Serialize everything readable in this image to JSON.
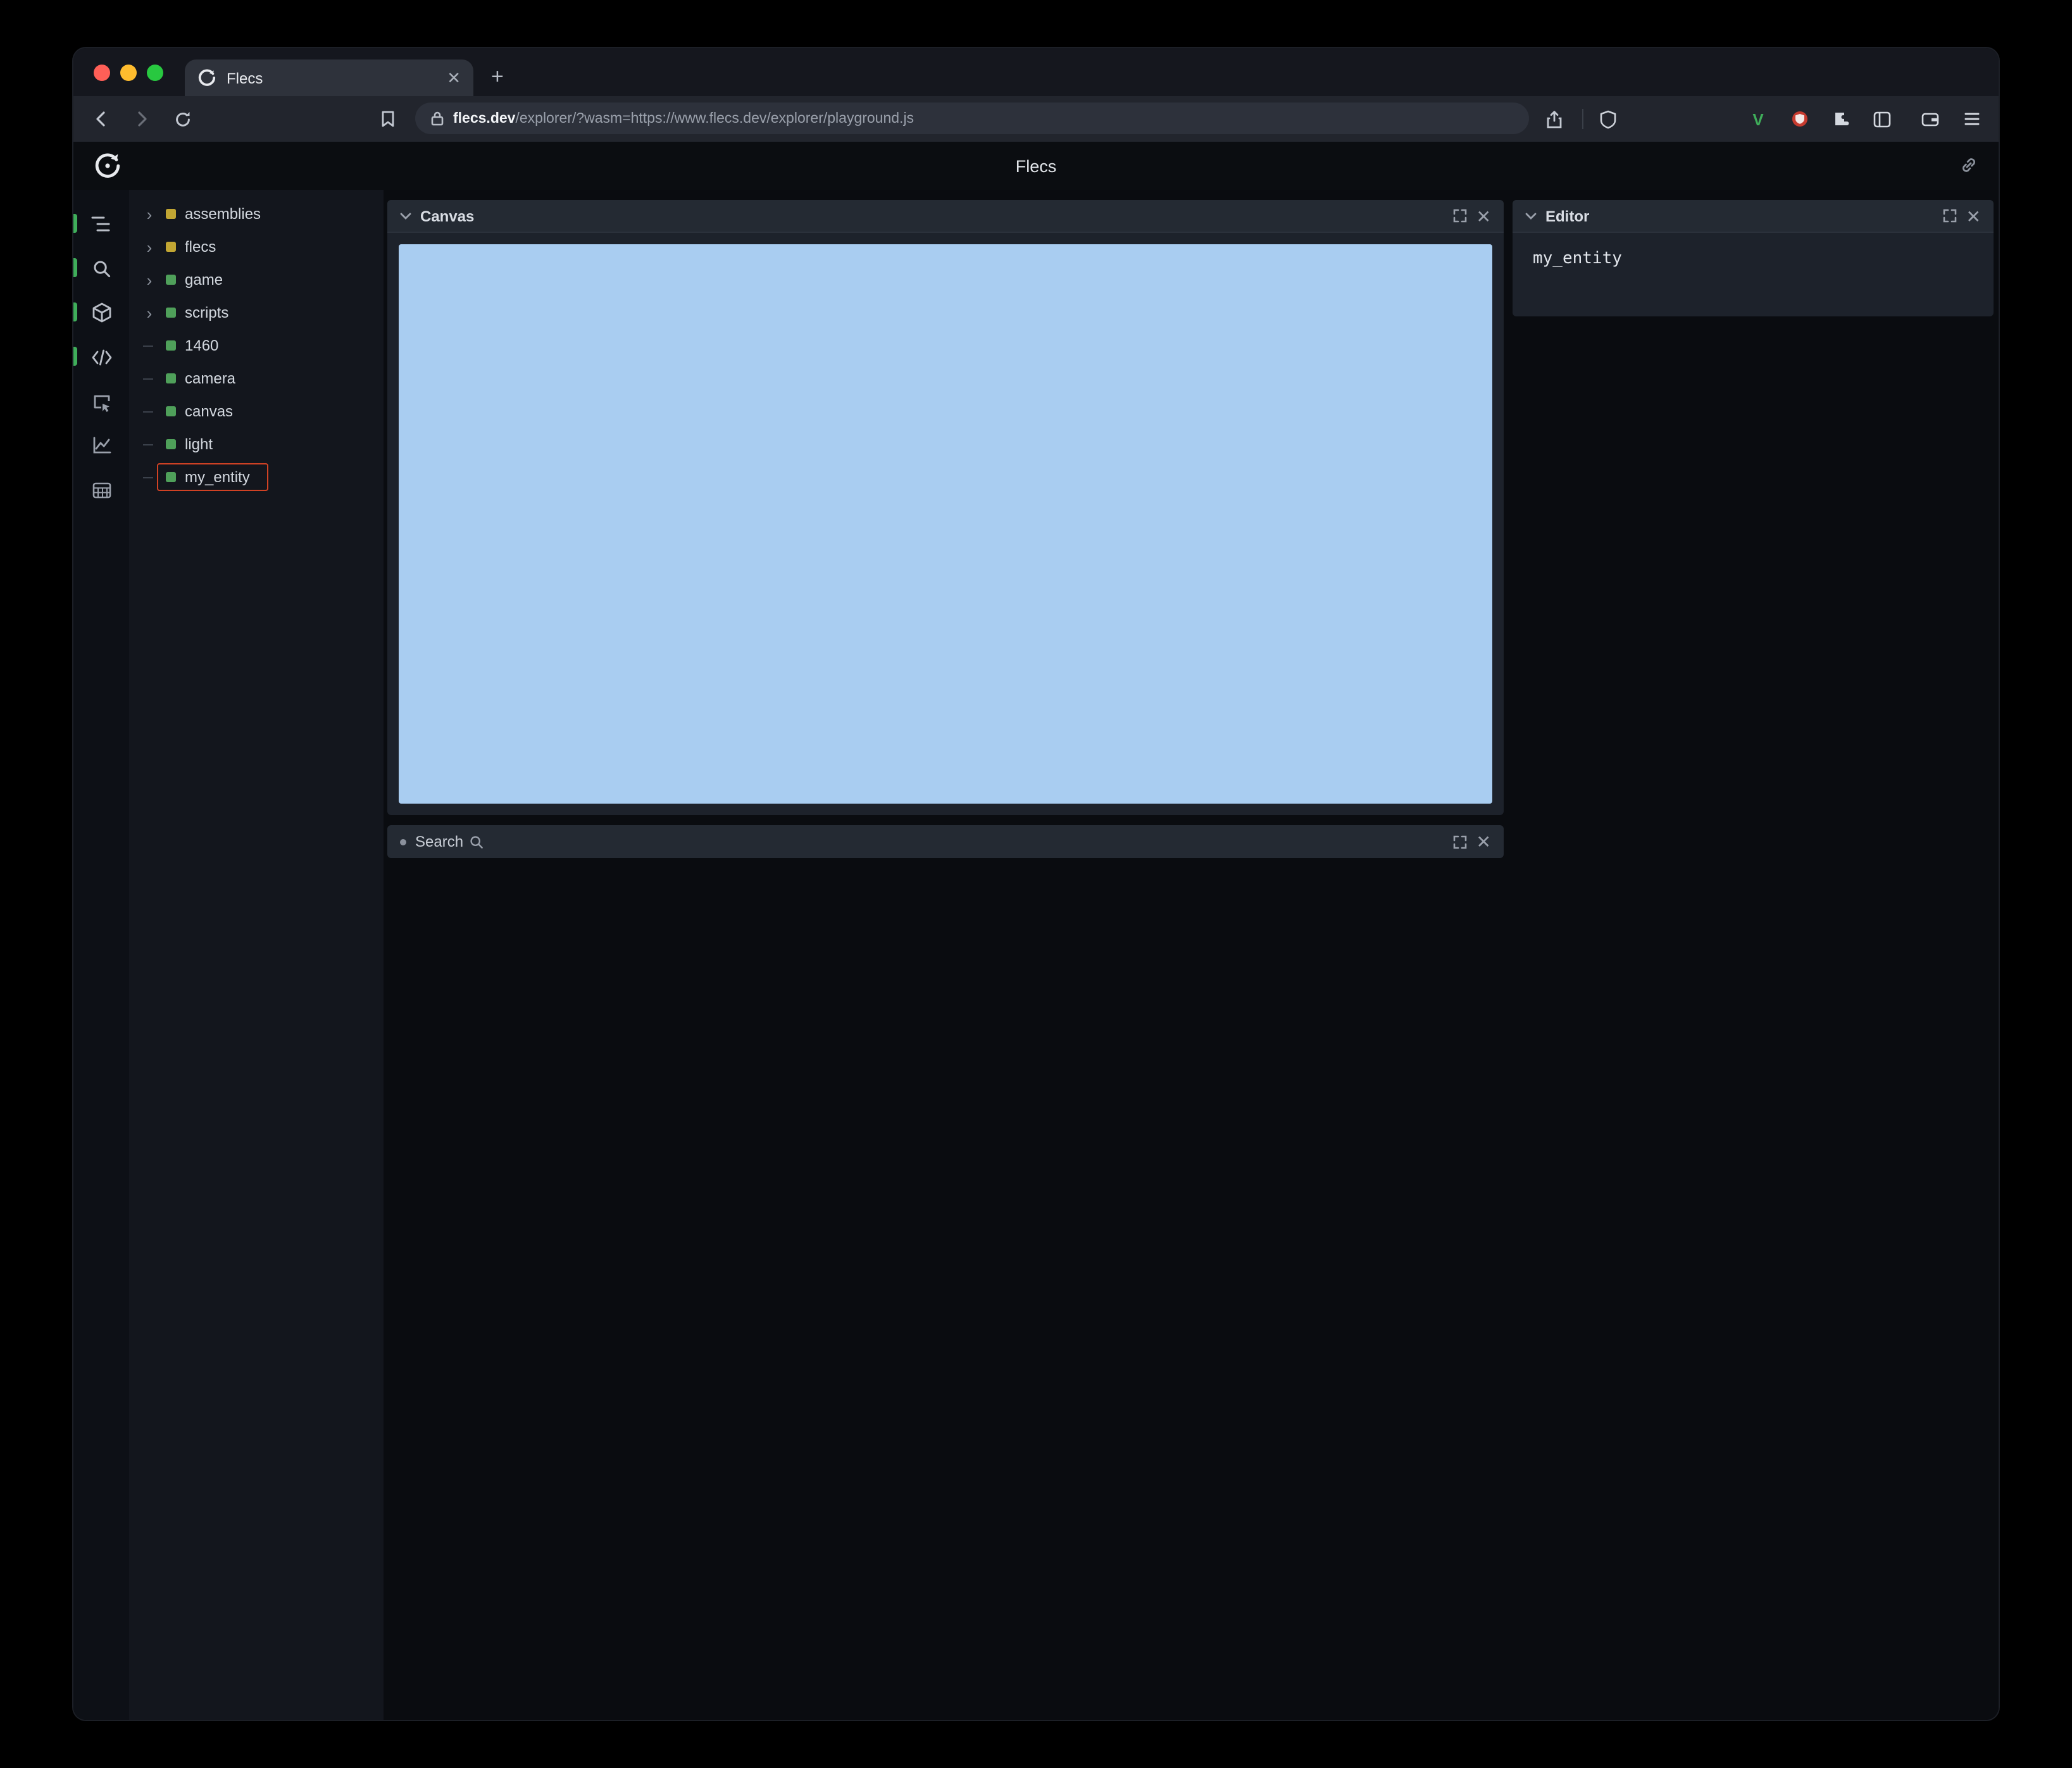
{
  "browser": {
    "tab_title": "Flecs",
    "url": {
      "domain": "flecs.dev",
      "path": "/explorer/?wasm=https://www.flecs.dev/explorer/playground.js"
    }
  },
  "app": {
    "title": "Flecs",
    "tree": {
      "items": [
        {
          "label": "assemblies",
          "color": "#c2a633",
          "expandable": true,
          "highlighted": false
        },
        {
          "label": "flecs",
          "color": "#c2a633",
          "expandable": true,
          "highlighted": false
        },
        {
          "label": "game",
          "color": "#4fa05a",
          "expandable": true,
          "highlighted": false
        },
        {
          "label": "scripts",
          "color": "#4fa05a",
          "expandable": true,
          "highlighted": false
        },
        {
          "label": "1460",
          "color": "#4fa05a",
          "expandable": false,
          "highlighted": false
        },
        {
          "label": "camera",
          "color": "#4fa05a",
          "expandable": false,
          "highlighted": false
        },
        {
          "label": "canvas",
          "color": "#4fa05a",
          "expandable": false,
          "highlighted": false
        },
        {
          "label": "light",
          "color": "#4fa05a",
          "expandable": false,
          "highlighted": false
        },
        {
          "label": "my_entity",
          "color": "#4fa05a",
          "expandable": false,
          "highlighted": true
        }
      ]
    },
    "panels": {
      "canvas": {
        "title": "Canvas",
        "canvas_color": "#a9cdf1"
      },
      "search": {
        "title": "Search"
      },
      "editor": {
        "title": "Editor",
        "content": "my_entity"
      }
    }
  },
  "colors": {
    "highlight_red": "#d14224",
    "active_green": "#3fae5a",
    "traffic_red": "#ff5f57",
    "traffic_yellow": "#febc2e",
    "traffic_green": "#28c840",
    "canvas_blue": "#a9cdf1",
    "v_extension_green": "#3fae5a",
    "shield_extension_red": "#c63b2f"
  }
}
